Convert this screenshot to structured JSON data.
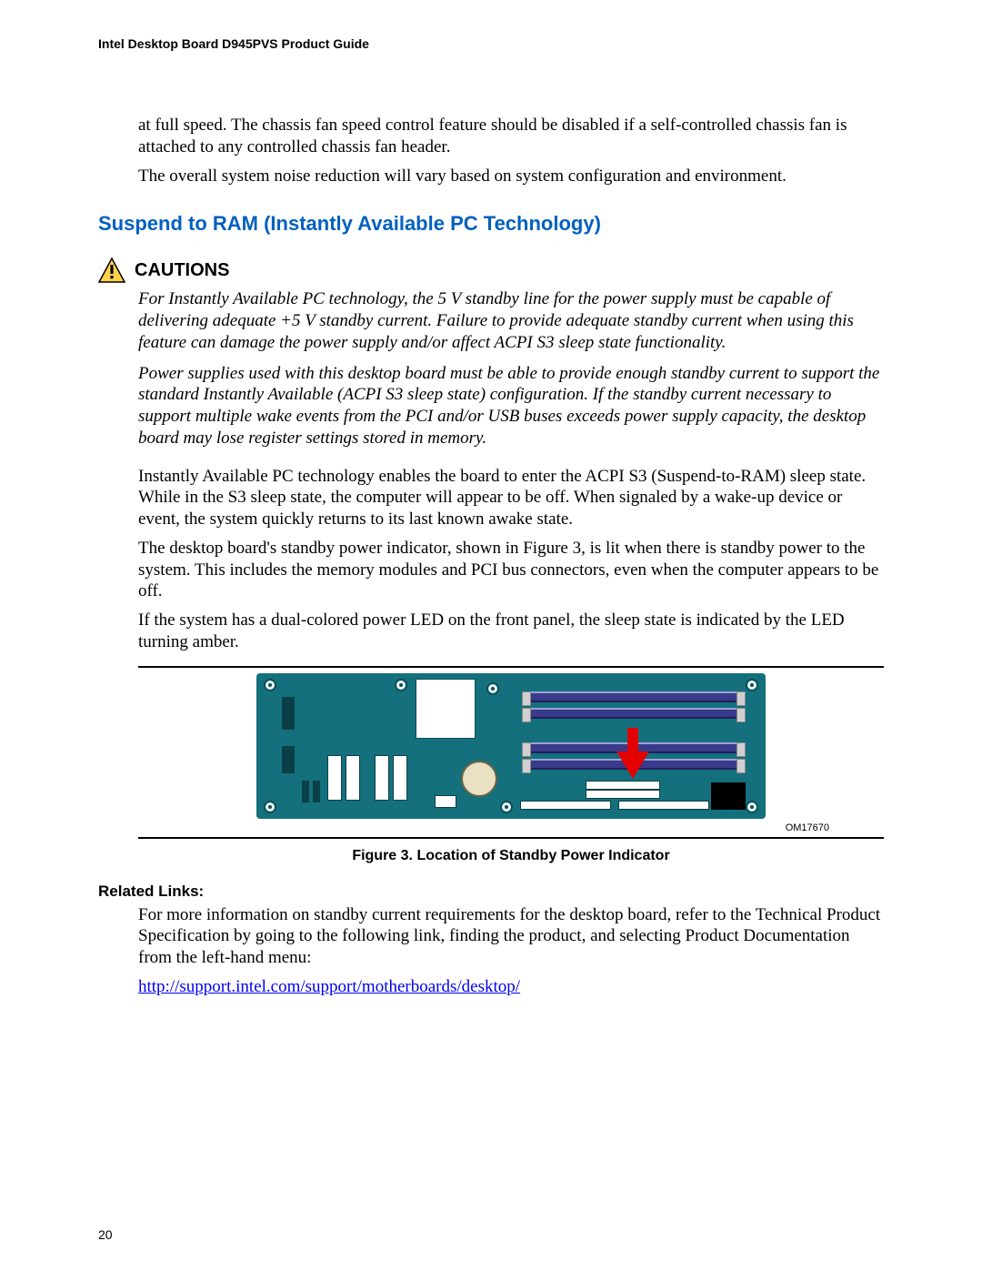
{
  "header": "Intel Desktop Board D945PVS Product Guide",
  "intro": {
    "p1": "at full speed.  The chassis fan speed control feature should be disabled if a self-controlled chassis fan is attached to any controlled chassis fan header.",
    "p2": "The overall system noise reduction will vary based on system configuration and environment."
  },
  "section_title": "Suspend to RAM (Instantly Available PC Technology)",
  "cautions_label": "CAUTIONS",
  "cautions": {
    "p1": "For Instantly Available PC technology, the 5 V standby line for the power supply must be capable of delivering adequate +5 V standby current.  Failure to provide adequate standby current when using this feature can damage the power supply and/or affect ACPI S3 sleep state functionality.",
    "p2": "Power supplies used with this desktop board must be able to provide enough standby current to support the standard Instantly Available (ACPI S3 sleep state) configuration.  If the standby current necessary to support multiple wake events from the PCI and/or USB buses exceeds power supply capacity, the desktop board may lose register settings stored in memory."
  },
  "body": {
    "p1": "Instantly Available PC technology enables the board to enter the ACPI S3 (Suspend-to-RAM) sleep state.  While in the S3 sleep state, the computer will appear to be off.  When signaled by a wake-up device or event, the system quickly returns to its last known awake state.",
    "p2": "The desktop board's standby power indicator, shown in Figure 3, is lit when there is standby power to the system.  This includes the memory modules and PCI bus connectors, even when the computer appears to be off.",
    "p3": "If the system has a dual-colored power LED on the front panel, the sleep state is indicated by the LED turning amber."
  },
  "figure": {
    "id": "OM17670",
    "caption": "Figure 3.  Location of Standby Power Indicator"
  },
  "related": {
    "heading": "Related Links:",
    "p1": "For more information on standby current requirements for the desktop board, refer to the Technical Product Specification by going to the following link, finding the product, and selecting Product Documentation from the left-hand menu:",
    "link": "http://support.intel.com/support/motherboards/desktop/"
  },
  "page_number": "20"
}
